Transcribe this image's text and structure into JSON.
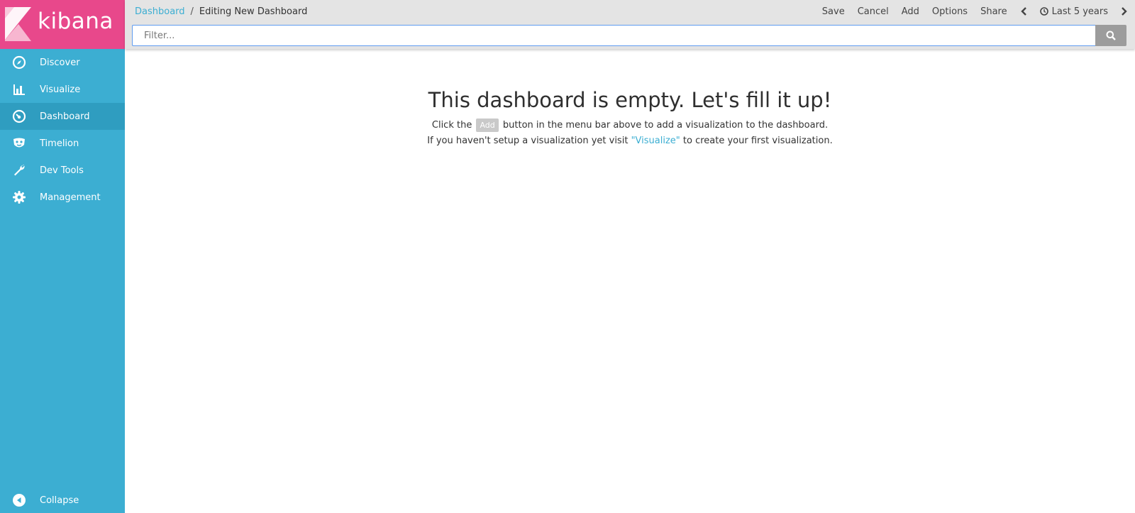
{
  "brand": {
    "name": "kibana",
    "color_primary": "#e8488b",
    "color_sidebar": "#3caed2"
  },
  "sidebar": {
    "items": [
      {
        "label": "Discover",
        "icon": "compass-icon"
      },
      {
        "label": "Visualize",
        "icon": "bar-chart-icon"
      },
      {
        "label": "Dashboard",
        "icon": "dashboard-gauge-icon",
        "active": true
      },
      {
        "label": "Timelion",
        "icon": "timelion-mask-icon"
      },
      {
        "label": "Dev Tools",
        "icon": "wrench-icon"
      },
      {
        "label": "Management",
        "icon": "gear-icon"
      }
    ],
    "collapse_label": "Collapse"
  },
  "topbar": {
    "breadcrumb": {
      "root": "Dashboard",
      "separator": "/",
      "current": "Editing New Dashboard"
    },
    "menu": {
      "save": "Save",
      "cancel": "Cancel",
      "add": "Add",
      "options": "Options",
      "share": "Share"
    },
    "time_range": "Last 5 years"
  },
  "filter": {
    "placeholder": "Filter..."
  },
  "empty_state": {
    "title": "This dashboard is empty. Let's fill it up!",
    "line1_before": "Click the",
    "line1_badge": "Add",
    "line1_after": "button in the menu bar above to add a visualization to the dashboard.",
    "line2_before": "If you haven't setup a visualization yet visit",
    "line2_link": "\"Visualize\"",
    "line2_after": "to create your first visualization."
  }
}
